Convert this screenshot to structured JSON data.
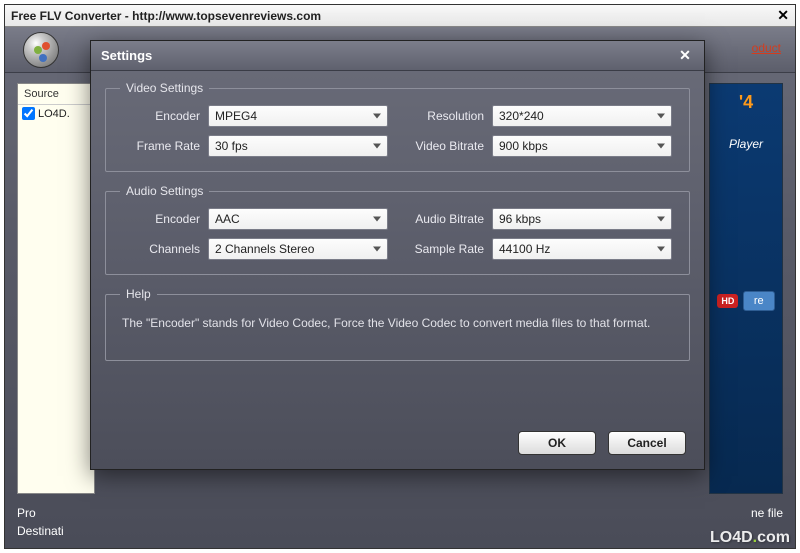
{
  "main": {
    "title": "Free FLV Converter - http://www.topsevenreviews.com",
    "product_link": "oduct",
    "source_header": "Source",
    "source_item": "LO4D.",
    "bottom": {
      "profile_label": "Pro",
      "destination_label": "Destinati",
      "tail": "ne file"
    },
    "ad": {
      "p4": "'4",
      "player": "Player",
      "hd": "HD",
      "more": "re"
    }
  },
  "dialog": {
    "title": "Settings",
    "video": {
      "legend": "Video Settings",
      "encoder_label": "Encoder",
      "encoder_value": "MPEG4",
      "framerate_label": "Frame Rate",
      "framerate_value": "30 fps",
      "resolution_label": "Resolution",
      "resolution_value": "320*240",
      "bitrate_label": "Video Bitrate",
      "bitrate_value": "900 kbps"
    },
    "audio": {
      "legend": "Audio Settings",
      "encoder_label": "Encoder",
      "encoder_value": "AAC",
      "channels_label": "Channels",
      "channels_value": "2 Channels Stereo",
      "bitrate_label": "Audio Bitrate",
      "bitrate_value": "96 kbps",
      "samplerate_label": "Sample Rate",
      "samplerate_value": "44100 Hz"
    },
    "help": {
      "legend": "Help",
      "text": "The \"Encoder\" stands for Video Codec, Force the Video Codec to convert media files to that format."
    },
    "buttons": {
      "ok": "OK",
      "cancel": "Cancel"
    }
  },
  "watermark": "LO4D.com"
}
